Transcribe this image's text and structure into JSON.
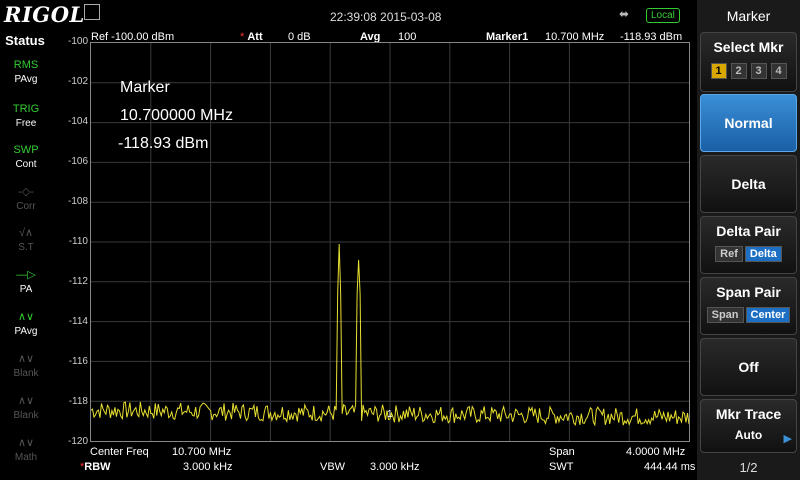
{
  "topbar": {
    "logo": "RIGOL",
    "datetime": "22:39:08 2015-03-08",
    "usb": "⬌",
    "local": "Local"
  },
  "header": {
    "ref": "Ref -100.00 dBm",
    "att_label": "Att",
    "att_value": "0 dB",
    "avg_label": "Avg",
    "avg_value": "100",
    "marker_label": "Marker1",
    "marker_freq": "10.700 MHz",
    "marker_amp": "-118.93 dBm"
  },
  "status": {
    "title": "Status",
    "items": [
      {
        "icon": "RMS",
        "label": "PAvg",
        "state": "on"
      },
      {
        "icon": "TRIG",
        "label": "Free",
        "state": "on"
      },
      {
        "icon": "SWP",
        "label": "Cont",
        "state": "on"
      },
      {
        "icon": "-◇-",
        "label": "Corr",
        "state": "off"
      },
      {
        "icon": "√∧",
        "label": "S.T",
        "state": "off"
      },
      {
        "icon": "—▷",
        "label": "PA",
        "state": "on"
      },
      {
        "icon": "∧∨",
        "label": "PAvg",
        "state": "on"
      },
      {
        "icon": "∧∨",
        "label": "Blank",
        "state": "off"
      },
      {
        "icon": "∧∨",
        "label": "Blank",
        "state": "off"
      },
      {
        "icon": "∧∨",
        "label": "Math",
        "state": "off"
      }
    ]
  },
  "yaxis": {
    "labels": [
      "-100",
      "-102",
      "-104",
      "-106",
      "-108",
      "-110",
      "-112",
      "-114",
      "-116",
      "-118",
      "-120"
    ]
  },
  "readout": {
    "title": "Marker",
    "freq": "10.700000 MHz",
    "amp": "-118.93 dBm",
    "marker_number": "1"
  },
  "bottom": {
    "center_label": "Center Freq",
    "center_value": "10.700 MHz",
    "rbw_label": "RBW",
    "rbw_value": "3.000 kHz",
    "vbw_label": "VBW",
    "vbw_value": "3.000 kHz",
    "span_label": "Span",
    "span_value": "4.0000 MHz",
    "swt_label": "SWT",
    "swt_value": "444.44 ms"
  },
  "menu": {
    "title": "Marker",
    "select_mkr": "Select Mkr",
    "markers": [
      "1",
      "2",
      "3",
      "4"
    ],
    "normal": "Normal",
    "delta": "Delta",
    "delta_pair": "Delta Pair",
    "delta_pair_ref": "Ref",
    "delta_pair_delta": "Delta",
    "span_pair": "Span Pair",
    "span_pair_span": "Span",
    "span_pair_center": "Center",
    "off": "Off",
    "mkr_trace": "Mkr Trace",
    "mkr_trace_value": "Auto",
    "page": "1/2"
  },
  "colors": {
    "trace": "#e8e030",
    "grid": "#3a3a3a",
    "accent": "#1c6fc3"
  },
  "chart_data": {
    "type": "line",
    "xlabel": "",
    "ylabel": "",
    "ylim": [
      -120,
      -100
    ],
    "x_center_mhz": 10.7,
    "x_span_mhz": 4.0,
    "peaks": [
      {
        "x_mhz": 10.36,
        "y": -110.1
      },
      {
        "x_mhz": 10.49,
        "y": -110.9
      }
    ],
    "noise_floor": -118.9,
    "grid": true
  }
}
